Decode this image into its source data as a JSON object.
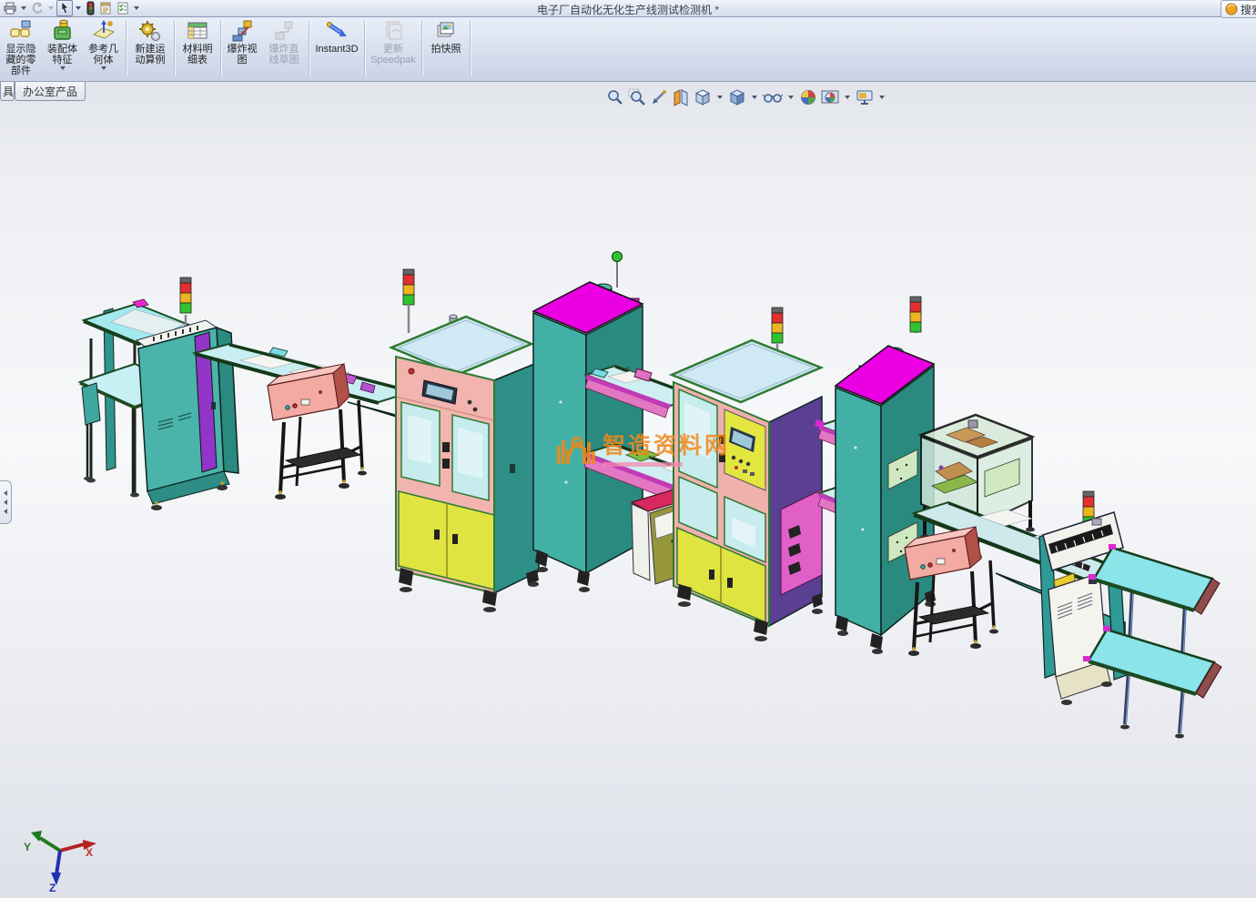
{
  "window": {
    "title": "电子厂自动化无化生产线测试检测机 *",
    "search_label": "搜索"
  },
  "ribbon": {
    "buttons": [
      {
        "label": "显示隐\n藏的零\n部件",
        "state": "enabled"
      },
      {
        "label": "装配体\n特征",
        "state": "enabled",
        "has_dropdown": true
      },
      {
        "label": "参考几\n何体",
        "state": "enabled",
        "has_dropdown": true
      },
      {
        "label": "新建运\n动算例",
        "state": "enabled"
      },
      {
        "label": "材料明\n细表",
        "state": "enabled"
      },
      {
        "label": "爆炸视\n图",
        "state": "enabled"
      },
      {
        "label": "爆炸直\n线草图",
        "state": "disabled"
      },
      {
        "label": "Instant3D",
        "state": "enabled"
      },
      {
        "label": "更新\nSpeedpak",
        "state": "disabled"
      },
      {
        "label": "拍快照",
        "state": "enabled"
      }
    ]
  },
  "tabs": {
    "partial": "具",
    "active": "办公室产品"
  },
  "viewport": {
    "watermark": "智造资料网",
    "triad": {
      "x": "X",
      "y": "Y",
      "z": "Z"
    }
  },
  "palette": {
    "machine_teal": "#45b2a8",
    "machine_teal_dark": "#2b8a80",
    "top_magenta": "#ea00e2",
    "panel_pink": "#f2b4ae",
    "door_yellow": "#dfe440",
    "conveyor_cyan": "#8fe6ec",
    "frame_green": "#1c4a22",
    "stack_red": "#e23030",
    "stack_yellow": "#ecb41e",
    "stack_green": "#2fc42f",
    "watermark_orange": "#f0881a"
  }
}
